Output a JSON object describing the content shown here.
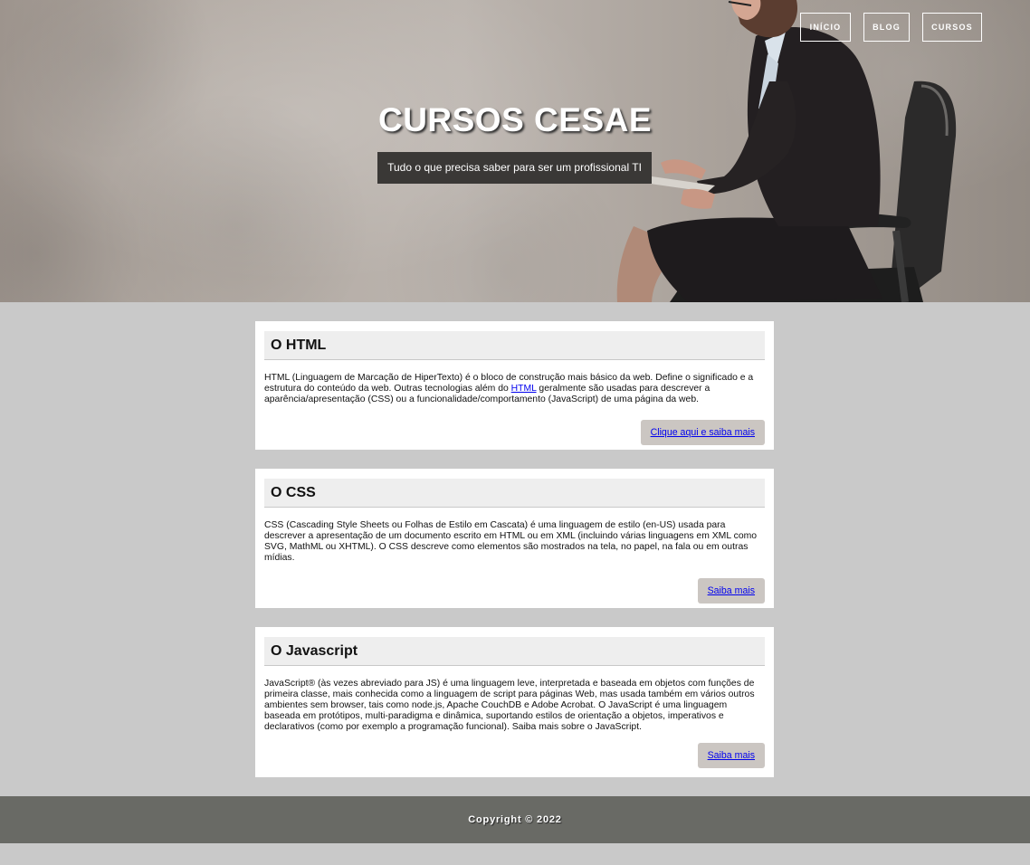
{
  "nav": {
    "items": [
      {
        "label": "INÍCIO"
      },
      {
        "label": "BLOG"
      },
      {
        "label": "CURSOS"
      }
    ]
  },
  "hero": {
    "title": "CURSOS CESAE",
    "subtitle": "Tudo o que precisa saber para ser um profissional TI"
  },
  "cards": [
    {
      "title": "O HTML",
      "text_before_link": "HTML (Linguagem de Marcação de HiperTexto) é o bloco de construção mais básico da web. Define o significado e a estrutura do conteúdo da web. Outras tecnologias além do ",
      "link": "HTML",
      "text_after_link": " geralmente são usadas para descrever a aparência/apresentação (CSS) ou a funcionalidade/comportamento (JavaScript) de uma página da web.",
      "button": "Clique aqui e saiba mais"
    },
    {
      "title": "O CSS",
      "text": "CSS (Cascading Style Sheets ou Folhas de Estilo em Cascata) é uma linguagem de estilo (en-US) usada para descrever a apresentação de um documento escrito em HTML ou em XML (incluindo várias linguagens em XML como SVG, MathML ou XHTML). O CSS descreve como elementos são mostrados na tela, no papel, na fala ou em outras mídias.",
      "button": "Saiba mais"
    },
    {
      "title": "O Javascript",
      "text": "JavaScript® (às vezes abreviado para JS) é uma linguagem leve, interpretada e baseada em objetos com funções de primeira classe, mais conhecida como a linguagem de script para páginas Web, mas usada também em vários outros ambientes sem browser, tais como node.js, Apache CouchDB e Adobe Acrobat. O JavaScript é uma linguagem baseada em protótipos, multi-paradigma e dinâmica, suportando estilos de orientação a objetos, imperativos e declarativos (como por exemplo a programação funcional). Saiba mais sobre o JavaScript.",
      "button": "Saiba mais"
    }
  ],
  "footer": {
    "copyright": "Copyright © 2022"
  },
  "colors": {
    "page_background": "#c9c9c9",
    "footer_background": "#696a65",
    "subtitle_background": "#3a3836",
    "button_background": "#cbc6c2",
    "card_header_background": "#eeeeee",
    "link": "#0000ee"
  },
  "icons": {
    "hero_image": "businesswoman-with-tablet-in-chair"
  }
}
